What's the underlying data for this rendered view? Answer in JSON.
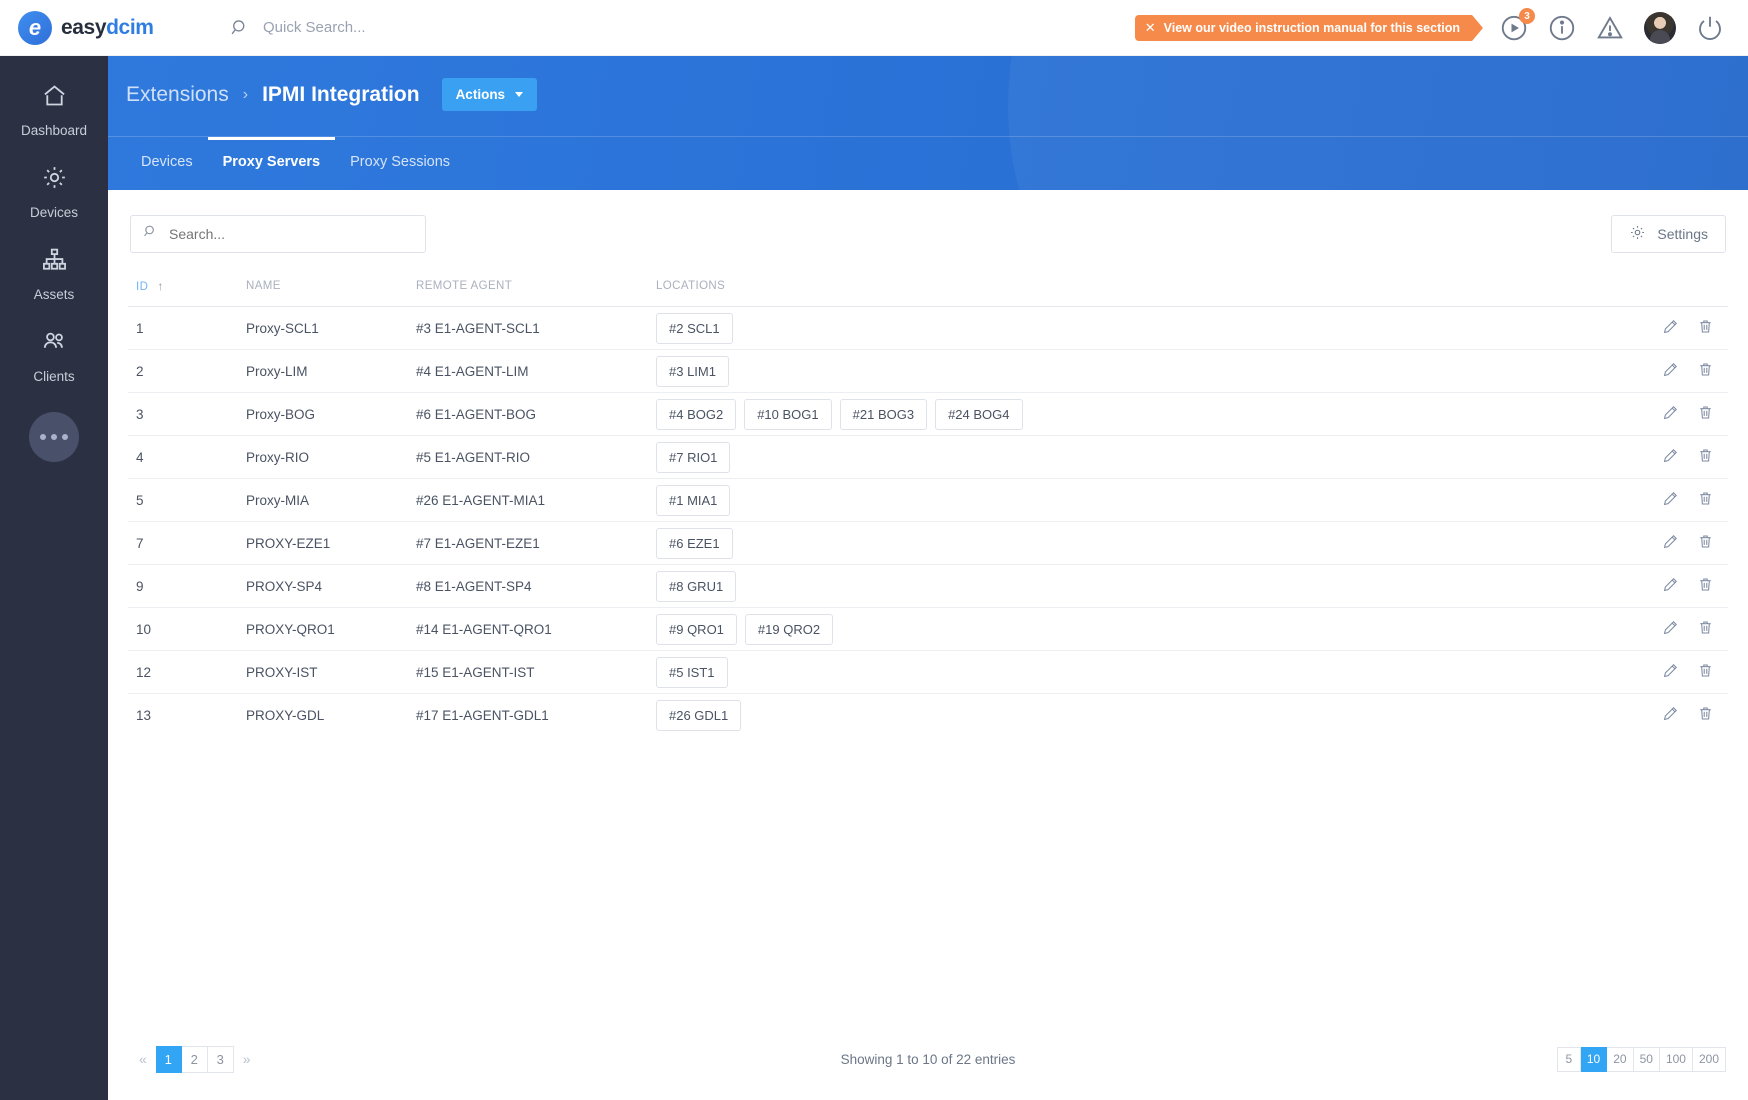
{
  "topbar": {
    "logo_easy": "easy",
    "logo_dcim": "dcim",
    "logo_glyph": "e",
    "quick_search_placeholder": "Quick Search...",
    "video_banner_close": "✕",
    "video_banner_text": "View our video instruction manual for this section",
    "video_badge": "3",
    "accent_orange": "#f58a4b"
  },
  "sidebar": {
    "items": [
      {
        "label": "Dashboard",
        "icon": "home-icon"
      },
      {
        "label": "Devices",
        "icon": "gear-icon"
      },
      {
        "label": "Assets",
        "icon": "sitemap-icon"
      },
      {
        "label": "Clients",
        "icon": "users-icon"
      }
    ],
    "more_label": "more-menu"
  },
  "header": {
    "breadcrumb_parent": "Extensions",
    "breadcrumb_separator": "›",
    "breadcrumb_current": "IPMI Integration",
    "actions_label": "Actions",
    "tabs": [
      {
        "label": "Devices",
        "active": false
      },
      {
        "label": "Proxy Servers",
        "active": true
      },
      {
        "label": "Proxy Sessions",
        "active": false
      }
    ],
    "accent_blue": "#2f79dd"
  },
  "toolbar": {
    "search_placeholder": "Search...",
    "search_value": "",
    "settings_label": "Settings"
  },
  "table": {
    "columns": [
      {
        "label": "ID",
        "sorted": true,
        "sort_arrow": "↑"
      },
      {
        "label": "NAME",
        "sorted": false
      },
      {
        "label": "REMOTE AGENT",
        "sorted": false
      },
      {
        "label": "LOCATIONS",
        "sorted": false
      }
    ],
    "rows": [
      {
        "id": "1",
        "name": "Proxy-SCL1",
        "agent": "#3 E1-AGENT-SCL1",
        "locations": [
          "#2 SCL1"
        ]
      },
      {
        "id": "2",
        "name": "Proxy-LIM",
        "agent": "#4 E1-AGENT-LIM",
        "locations": [
          "#3 LIM1"
        ]
      },
      {
        "id": "3",
        "name": "Proxy-BOG",
        "agent": "#6 E1-AGENT-BOG",
        "locations": [
          "#4 BOG2",
          "#10 BOG1",
          "#21 BOG3",
          "#24 BOG4"
        ]
      },
      {
        "id": "4",
        "name": "Proxy-RIO",
        "agent": "#5 E1-AGENT-RIO",
        "locations": [
          "#7 RIO1"
        ]
      },
      {
        "id": "5",
        "name": "Proxy-MIA",
        "agent": "#26 E1-AGENT-MIA1",
        "locations": [
          "#1 MIA1"
        ]
      },
      {
        "id": "7",
        "name": "PROXY-EZE1",
        "agent": "#7 E1-AGENT-EZE1",
        "locations": [
          "#6 EZE1"
        ]
      },
      {
        "id": "9",
        "name": "PROXY-SP4",
        "agent": "#8 E1-AGENT-SP4",
        "locations": [
          "#8 GRU1"
        ]
      },
      {
        "id": "10",
        "name": "PROXY-QRO1",
        "agent": "#14 E1-AGENT-QRO1",
        "locations": [
          "#9 QRO1",
          "#19 QRO2"
        ]
      },
      {
        "id": "12",
        "name": "PROXY-IST",
        "agent": "#15 E1-AGENT-IST",
        "locations": [
          "#5 IST1"
        ]
      },
      {
        "id": "13",
        "name": "PROXY-GDL",
        "agent": "#17 E1-AGENT-GDL1",
        "locations": [
          "#26 GDL1"
        ]
      }
    ],
    "row_actions": [
      "edit-icon",
      "delete-icon"
    ]
  },
  "footer": {
    "prev_symbol": "«",
    "next_symbol": "»",
    "pages": [
      "1",
      "2",
      "3"
    ],
    "active_page": "1",
    "entries_text": "Showing 1 to 10 of 22 entries",
    "page_sizes": [
      "5",
      "10",
      "20",
      "50",
      "100",
      "200"
    ],
    "active_page_size": "10"
  }
}
